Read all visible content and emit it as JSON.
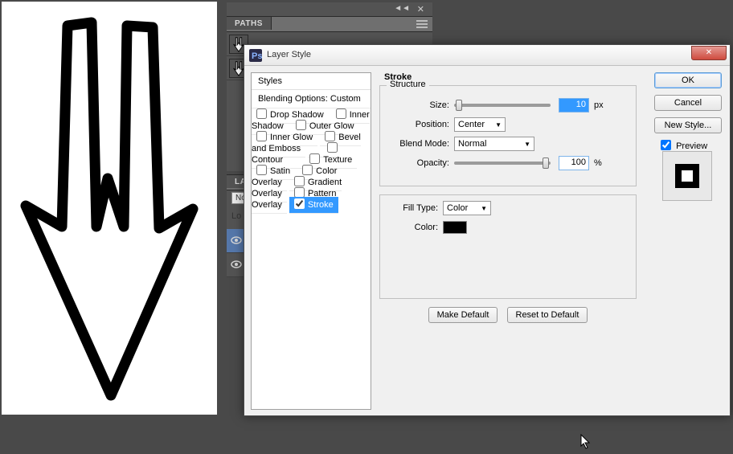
{
  "canvas": {
    "alt": "black arrow shape"
  },
  "paths_panel": {
    "tab": "PATHS"
  },
  "layers_panel": {
    "tab": "LAY",
    "mode_short": "No",
    "lock_short": "Lo"
  },
  "dialog": {
    "title": "Layer Style",
    "styles_header": "Styles",
    "blending_options": "Blending Options: Custom",
    "items": {
      "drop_shadow": "Drop Shadow",
      "inner_shadow": "Inner Shadow",
      "outer_glow": "Outer Glow",
      "inner_glow": "Inner Glow",
      "bevel_emboss": "Bevel and Emboss",
      "contour": "Contour",
      "texture": "Texture",
      "satin": "Satin",
      "color_overlay": "Color Overlay",
      "gradient_overlay": "Gradient Overlay",
      "pattern_overlay": "Pattern Overlay",
      "stroke": "Stroke"
    },
    "stroke": {
      "title": "Stroke",
      "structure_legend": "Structure",
      "size_label": "Size:",
      "size_value": "10",
      "size_unit": "px",
      "position_label": "Position:",
      "position_value": "Center",
      "blend_label": "Blend Mode:",
      "blend_value": "Normal",
      "opacity_label": "Opacity:",
      "opacity_value": "100",
      "opacity_unit": "%",
      "filltype_label": "Fill Type:",
      "filltype_value": "Color",
      "color_label": "Color:",
      "color_value": "#000000",
      "make_default": "Make Default",
      "reset_default": "Reset to Default"
    },
    "buttons": {
      "ok": "OK",
      "cancel": "Cancel",
      "new_style": "New Style...",
      "preview": "Preview"
    }
  }
}
